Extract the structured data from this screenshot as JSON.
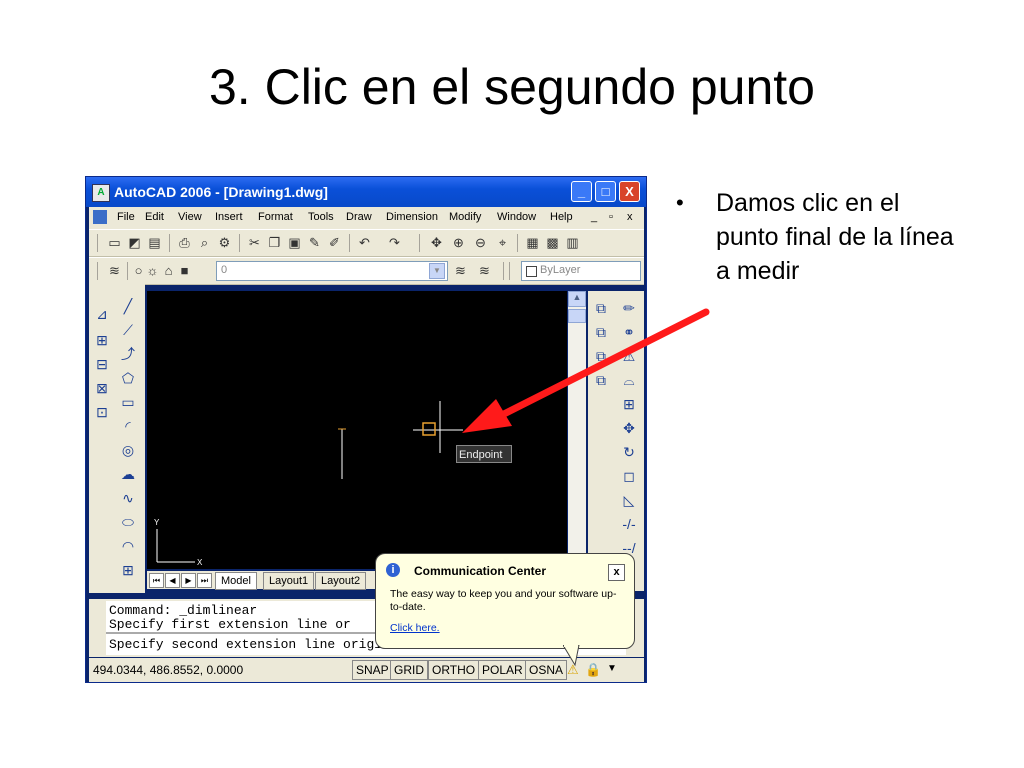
{
  "slide": {
    "title": "3. Clic en el segundo punto",
    "bullet": "Damos clic en el punto final de la línea a medir"
  },
  "window": {
    "title": "AutoCAD 2006 - [Drawing1.dwg]",
    "buttons": {
      "minimize": "_",
      "maximize": "□",
      "close": "X"
    }
  },
  "menu": [
    "File",
    "Edit",
    "View",
    "Insert",
    "Format",
    "Tools",
    "Draw",
    "Dimension",
    "Modify",
    "Window",
    "Help"
  ],
  "layers": {
    "current_layer": "0",
    "bylayer": "ByLayer"
  },
  "tabs": [
    "Model",
    "Layout1",
    "Layout2"
  ],
  "drawing": {
    "tooltip": "Endpoint",
    "axis_x": "X",
    "axis_y": "Y"
  },
  "command": {
    "lines": [
      "Command: _dimlinear",
      "Specify first extension line or",
      "Specify second extension line origin"
    ]
  },
  "status": {
    "coords": "494.0344, 486.8552, 0.0000",
    "buttons": [
      "SNAP",
      "GRID",
      "ORTHO",
      "POLAR",
      "OSNA"
    ]
  },
  "balloon": {
    "title": "Communication Center",
    "text": "The easy way to keep you and your software up-to-date.",
    "link": "Click here.",
    "close": "x"
  },
  "colors": {
    "titlebar": "#0a50d8",
    "arrow": "#ff1a1a",
    "drawing_bg": "#000000"
  }
}
